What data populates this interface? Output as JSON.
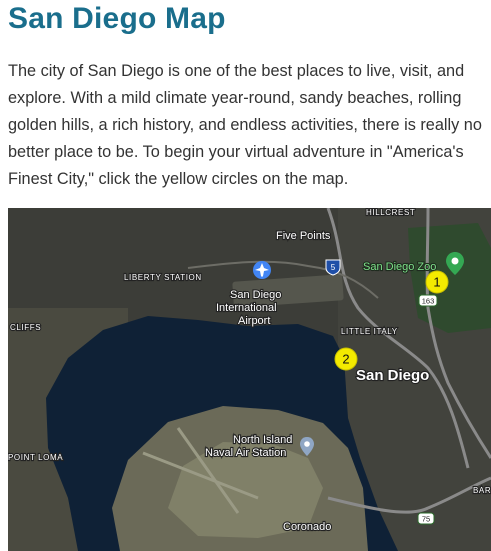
{
  "page": {
    "title": "San Diego Map",
    "intro": "The city of San Diego is one of the best places to live, visit, and explore. With a mild climate year-round, sandy beaches, rolling golden hills, a rich history, and endless activities, there is really no better place to be. To begin your virtual adventure in \"America's Finest City,\" click the yellow circles on the map."
  },
  "map": {
    "labels": {
      "hillcrest": "HILLCREST",
      "five_points": "Five Points",
      "san_diego_zoo": "San Diego Zoo",
      "liberty_station": "LIBERTY STATION",
      "airport_line1": "San Diego",
      "airport_line2": "International",
      "airport_line3": "Airport",
      "cliffs": "CLIFFS",
      "little_italy": "LITTLE ITALY",
      "san_diego": "San Diego",
      "north_island_line1": "North Island",
      "north_island_line2": "Naval Air Station",
      "point_loma": "POINT LOMA",
      "bar": "BAR",
      "coronado": "Coronado"
    },
    "shields": {
      "i5": "5",
      "sr163": "163",
      "sr75": "75"
    },
    "markers": [
      {
        "label": "1"
      },
      {
        "label": "2"
      }
    ],
    "colors": {
      "marker_fill": "#f4ea00",
      "water": "#0f2136",
      "land": "#3b3c37",
      "zoo_pin": "#34a853",
      "airport_pin": "#4285f4"
    }
  }
}
